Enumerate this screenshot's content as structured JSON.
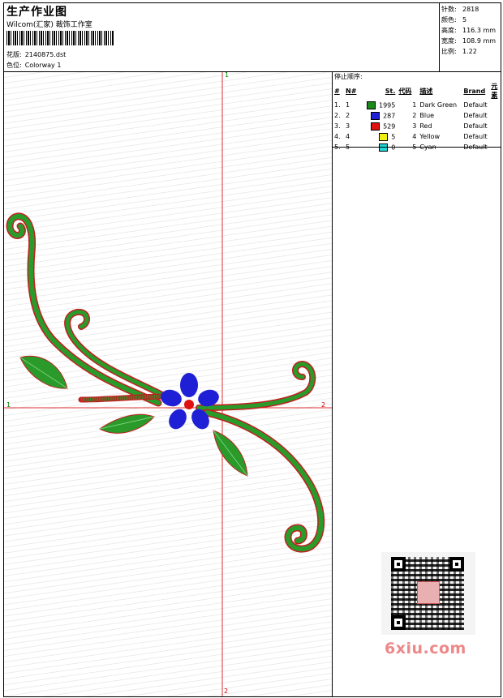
{
  "header": {
    "title": "生产作业图",
    "studio": "Wilcom(汇家) 裁饰工作室",
    "design_label": "花版:",
    "design_value": "2140875.dst",
    "colorway_label": "色位:",
    "colorway_value": "Colorway 1"
  },
  "stats": {
    "stitches_label": "针数:",
    "stitches_value": "2818",
    "colors_label": "颜色:",
    "colors_value": "5",
    "height_label": "高度:",
    "height_value": "116.3 mm",
    "width_label": "宽度:",
    "width_value": "108.9 mm",
    "scale_label": "比例:",
    "scale_value": "1.22"
  },
  "stop_sequence": {
    "title": "停止顺序:",
    "headers": [
      "#",
      "N#",
      "St.",
      "代码",
      "描述",
      "Brand",
      "元素"
    ],
    "rows": [
      {
        "idx": "1.",
        "n": "1",
        "st": "1995",
        "code": "1",
        "desc": "Dark Green",
        "brand": "Default",
        "color": "#1a8a1a"
      },
      {
        "idx": "2.",
        "n": "2",
        "st": "287",
        "code": "2",
        "desc": "Blue",
        "brand": "Default",
        "color": "#1f1fd6"
      },
      {
        "idx": "3.",
        "n": "3",
        "st": "529",
        "code": "3",
        "desc": "Red",
        "brand": "Default",
        "color": "#e01010"
      },
      {
        "idx": "4.",
        "n": "4",
        "st": "5",
        "code": "4",
        "desc": "Yellow",
        "brand": "Default",
        "color": "#f2ee10"
      },
      {
        "idx": "5.",
        "n": "5",
        "st": "0",
        "code": "5",
        "desc": "Cyan",
        "brand": "Default",
        "color": "#20d8d8"
      }
    ]
  },
  "axes": {
    "top": "1",
    "bottom": "2",
    "left": "1",
    "right": "2"
  },
  "watermark": {
    "brand": "6xiu.com"
  }
}
